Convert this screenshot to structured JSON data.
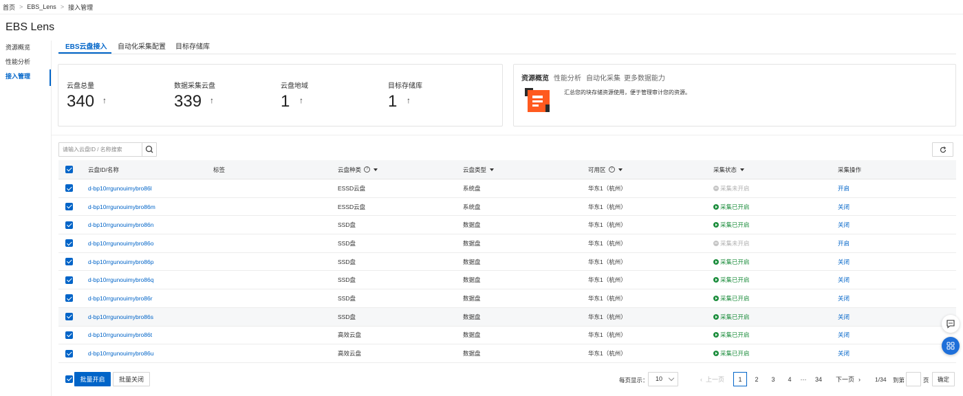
{
  "breadcrumb": [
    "首页",
    "EBS_Lens",
    "接入管理"
  ],
  "title": "EBS Lens",
  "sidebar": {
    "items": [
      {
        "label": "资源概览",
        "active": false
      },
      {
        "label": "性能分析",
        "active": false
      },
      {
        "label": "接入管理",
        "active": true
      }
    ]
  },
  "tabs": [
    {
      "label": "EBS云盘接入",
      "active": true
    },
    {
      "label": "自动化采集配置",
      "active": false
    },
    {
      "label": "目标存储库",
      "active": false
    }
  ],
  "stats": [
    {
      "label": "云盘总量",
      "value": "340",
      "trend": "↑"
    },
    {
      "label": "数据采集云盘",
      "value": "339",
      "trend": "↑"
    },
    {
      "label": "云盘地域",
      "value": "1",
      "trend": "↑"
    },
    {
      "label": "目标存储库",
      "value": "1",
      "trend": "↑"
    }
  ],
  "info_card": {
    "tabs": [
      "资源概览",
      "性能分析",
      "自动化采集",
      "更多数据能力"
    ],
    "description": "汇总您的块存储资源使用，便于管理审计您的资源。",
    "icon": "document-icon"
  },
  "search": {
    "placeholder": "请输入云盘ID / 名称搜索",
    "value": ""
  },
  "table": {
    "headers": {
      "id": "云盘ID/名称",
      "tags": "标签",
      "kind": "云盘种类",
      "type": "云盘类型",
      "zone": "可用区",
      "status": "采集状态",
      "action": "采集操作"
    },
    "rows": [
      {
        "id": "d-bp10rrgunouimybro86l",
        "kind": "ESSD云盘",
        "type": "系统盘",
        "zone": "华东1（杭州）",
        "status": "采集未开启",
        "on": false,
        "action": "开启"
      },
      {
        "id": "d-bp10rrgunouimybro86m",
        "kind": "ESSD云盘",
        "type": "系统盘",
        "zone": "华东1（杭州）",
        "status": "采集已开启",
        "on": true,
        "action": "关闭"
      },
      {
        "id": "d-bp10rrgunouimybro86n",
        "kind": "SSD盘",
        "type": "数据盘",
        "zone": "华东1（杭州）",
        "status": "采集已开启",
        "on": true,
        "action": "关闭"
      },
      {
        "id": "d-bp10rrgunouimybro86o",
        "kind": "SSD盘",
        "type": "数据盘",
        "zone": "华东1（杭州）",
        "status": "采集未开启",
        "on": false,
        "action": "开启"
      },
      {
        "id": "d-bp10rrgunouimybro86p",
        "kind": "SSD盘",
        "type": "数据盘",
        "zone": "华东1（杭州）",
        "status": "采集已开启",
        "on": true,
        "action": "关闭"
      },
      {
        "id": "d-bp10rrgunouimybro86q",
        "kind": "SSD盘",
        "type": "数据盘",
        "zone": "华东1（杭州）",
        "status": "采集已开启",
        "on": true,
        "action": "关闭"
      },
      {
        "id": "d-bp10rrgunouimybro86r",
        "kind": "SSD盘",
        "type": "数据盘",
        "zone": "华东1（杭州）",
        "status": "采集已开启",
        "on": true,
        "action": "关闭"
      },
      {
        "id": "d-bp10rrgunouimybro86s",
        "kind": "SSD盘",
        "type": "数据盘",
        "zone": "华东1（杭州）",
        "status": "采集已开启",
        "on": true,
        "action": "关闭"
      },
      {
        "id": "d-bp10rrgunouimybro86t",
        "kind": "高效云盘",
        "type": "数据盘",
        "zone": "华东1（杭州）",
        "status": "采集已开启",
        "on": true,
        "action": "关闭"
      },
      {
        "id": "d-bp10rrgunouimybro86u",
        "kind": "高效云盘",
        "type": "数据盘",
        "zone": "华东1（杭州）",
        "status": "采集已开启",
        "on": true,
        "action": "关闭"
      }
    ]
  },
  "footer": {
    "batch_enable": "批量开启",
    "batch_disable": "批量关闭",
    "page_size_label": "每页显示：",
    "page_size": "10",
    "prev": "上一页",
    "next": "下一页",
    "pages": [
      "1",
      "2",
      "3",
      "4"
    ],
    "ellipsis": "···",
    "last_page": "34",
    "current_page": "1",
    "page_indicator": "1/34",
    "goto_label": "到第",
    "page_unit": "页",
    "confirm": "确定"
  },
  "colors": {
    "primary": "#0064c8",
    "success": "#1e8e3e",
    "disabled": "#b0b0b0",
    "icon_orange": "#ff5a1f"
  }
}
